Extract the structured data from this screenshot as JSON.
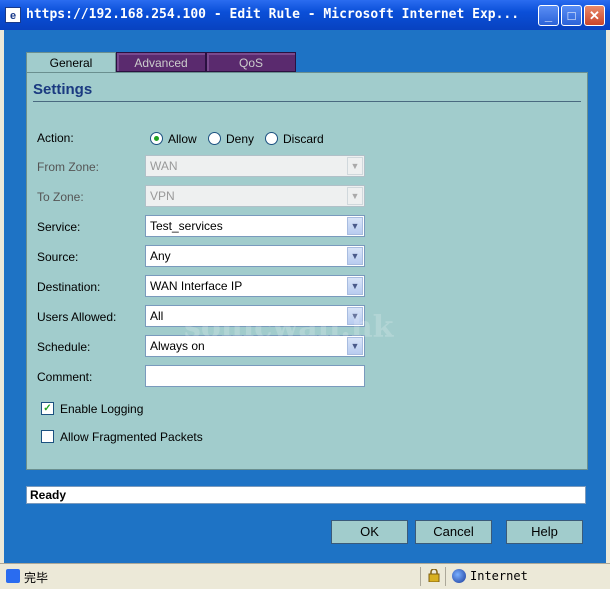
{
  "window": {
    "title": "https://192.168.254.100 - Edit Rule - Microsoft Internet Exp...",
    "min_glyph": "_",
    "max_glyph": "□",
    "close_glyph": "✕"
  },
  "tabs": [
    {
      "label": "General",
      "active": true
    },
    {
      "label": "Advanced",
      "active": false
    },
    {
      "label": "QoS",
      "active": false
    }
  ],
  "settings": {
    "title": "Settings",
    "action": {
      "label": "Action:",
      "options": [
        "Allow",
        "Deny",
        "Discard"
      ],
      "selected": "Allow"
    },
    "from_zone": {
      "label": "From Zone:",
      "value": "WAN"
    },
    "to_zone": {
      "label": "To Zone:",
      "value": "VPN"
    },
    "service": {
      "label": "Service:",
      "value": "Test_services"
    },
    "source": {
      "label": "Source:",
      "value": "Any"
    },
    "destination": {
      "label": "Destination:",
      "value": "WAN Interface IP"
    },
    "users_allowed": {
      "label": "Users Allowed:",
      "value": "All"
    },
    "schedule": {
      "label": "Schedule:",
      "value": "Always on"
    },
    "comment": {
      "label": "Comment:",
      "value": ""
    },
    "enable_logging": {
      "label": "Enable Logging",
      "checked": true
    },
    "allow_fragmented": {
      "label": "Allow Fragmented Packets",
      "checked": false
    }
  },
  "watermark": "sonicwall.hk",
  "status": "Ready",
  "buttons": {
    "ok": "OK",
    "cancel": "Cancel",
    "help": "Help"
  },
  "statusbar": {
    "text": "完毕",
    "zone": "Internet"
  },
  "colors": {
    "panel": "#a1cccc",
    "frame": "#1e73c5",
    "heading": "#1a3a80"
  }
}
